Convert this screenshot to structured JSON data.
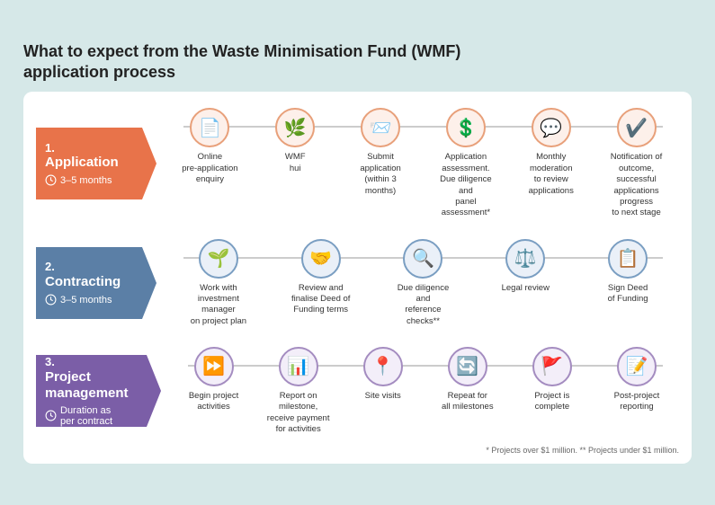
{
  "title": "What to expect from the Waste Minimisation Fund (WMF)\napplication process",
  "sections": [
    {
      "id": "application",
      "number": "1.",
      "name": "Application",
      "time": "3–5 months",
      "color_class": "arrow-label-1",
      "circle_class": "step-circle-1",
      "steps": [
        {
          "icon": "📄",
          "label": "Online\npre-application\nenquiry"
        },
        {
          "icon": "🌿",
          "label": "WMF\nhui"
        },
        {
          "icon": "📨",
          "label": "Submit\napplication\n(within 3 months)"
        },
        {
          "icon": "💲",
          "label": "Application\nassessment.\nDue diligence and\npanel assessment*"
        },
        {
          "icon": "💬",
          "label": "Monthly\nmoderation\nto review\napplications"
        },
        {
          "icon": "✔️",
          "label": "Notification of\noutcome, successful\napplications progress\nto next stage"
        }
      ]
    },
    {
      "id": "contracting",
      "number": "2.",
      "name": "Contracting",
      "time": "3–5 months",
      "color_class": "arrow-label-2",
      "circle_class": "step-circle-2",
      "steps": [
        {
          "icon": "🌱",
          "label": "Work with\ninvestment manager\non project plan"
        },
        {
          "icon": "🤝",
          "label": "Review and\nfinalise Deed of\nFunding terms"
        },
        {
          "icon": "🔍",
          "label": "Due diligence and\nreference checks**"
        },
        {
          "icon": "⚖️",
          "label": "Legal review"
        },
        {
          "icon": "📋",
          "label": "Sign Deed\nof Funding"
        }
      ]
    },
    {
      "id": "project-management",
      "number": "3.",
      "name": "Project\nmanagement",
      "time": "Duration as\nper contract",
      "color_class": "arrow-label-3",
      "circle_class": "step-circle-3",
      "steps": [
        {
          "icon": "⏩",
          "label": "Begin project\nactivities"
        },
        {
          "icon": "📊",
          "label": "Report on milestone,\nreceive payment\nfor activities"
        },
        {
          "icon": "📍",
          "label": "Site visits"
        },
        {
          "icon": "🔄",
          "label": "Repeat for\nall milestones"
        },
        {
          "icon": "🚩",
          "label": "Project is\ncomplete"
        },
        {
          "icon": "📝",
          "label": "Post-project\nreporting"
        }
      ]
    }
  ],
  "footnote": "* Projects over $1 million.   ** Projects under $1 million."
}
